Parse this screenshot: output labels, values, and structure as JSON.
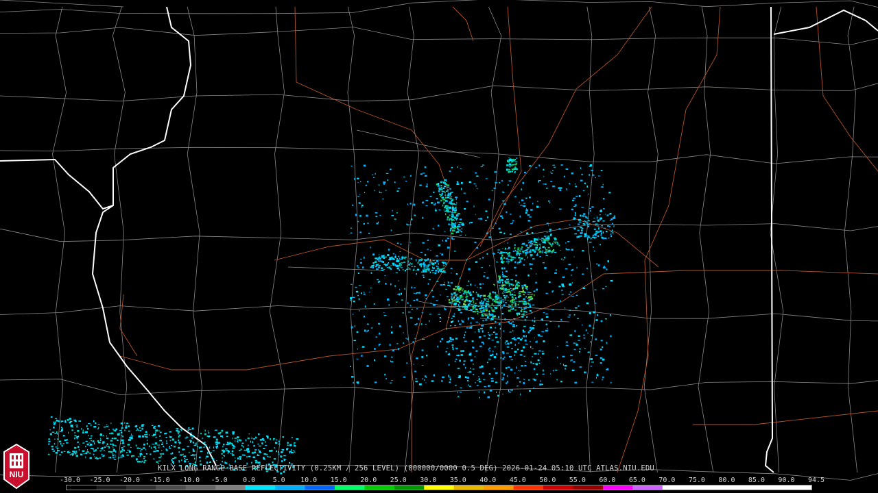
{
  "caption": "KILX LONG RANGE BASE REFLECTIVITY (0.25KM / 256 LEVEL) (000000/0000 0.5 DEG) 2026-01-24 05:10 UTC  ATLAS.NIU.EDU",
  "logo_text": "NIU",
  "scale": {
    "ticks": [
      "-30.0",
      "-25.0",
      "-20.0",
      "-15.0",
      "-10.0",
      "-5.0",
      "0.0",
      "5.0",
      "10.0",
      "15.0",
      "20.0",
      "25.0",
      "30.0",
      "35.0",
      "40.0",
      "45.0",
      "50.0",
      "55.0",
      "60.0",
      "65.0",
      "70.0",
      "75.0",
      "80.0",
      "85.0",
      "90.0",
      "94.5"
    ],
    "colors": [
      "#000000",
      "#1a1a1a",
      "#333333",
      "#4d4d4d",
      "#666666",
      "#808080",
      "#00e5ff",
      "#00b0ff",
      "#0066ff",
      "#00ff66",
      "#00cc00",
      "#009900",
      "#ffff00",
      "#e6b800",
      "#ff9900",
      "#ff3300",
      "#cc0000",
      "#990000",
      "#ff00ff",
      "#cc66ff",
      "#ffffff",
      "#ffffff",
      "#ffffff",
      "#ffffff",
      "#ffffff"
    ]
  },
  "map": {
    "background": "#000000",
    "county_color": "#8a8a8a",
    "state_color": "#ffffff",
    "road_color": "#b4532a",
    "echo_colors": [
      "#00b4ff",
      "#00e0ff",
      "#00d2c8",
      "#1ec850",
      "#78dc3c"
    ]
  }
}
